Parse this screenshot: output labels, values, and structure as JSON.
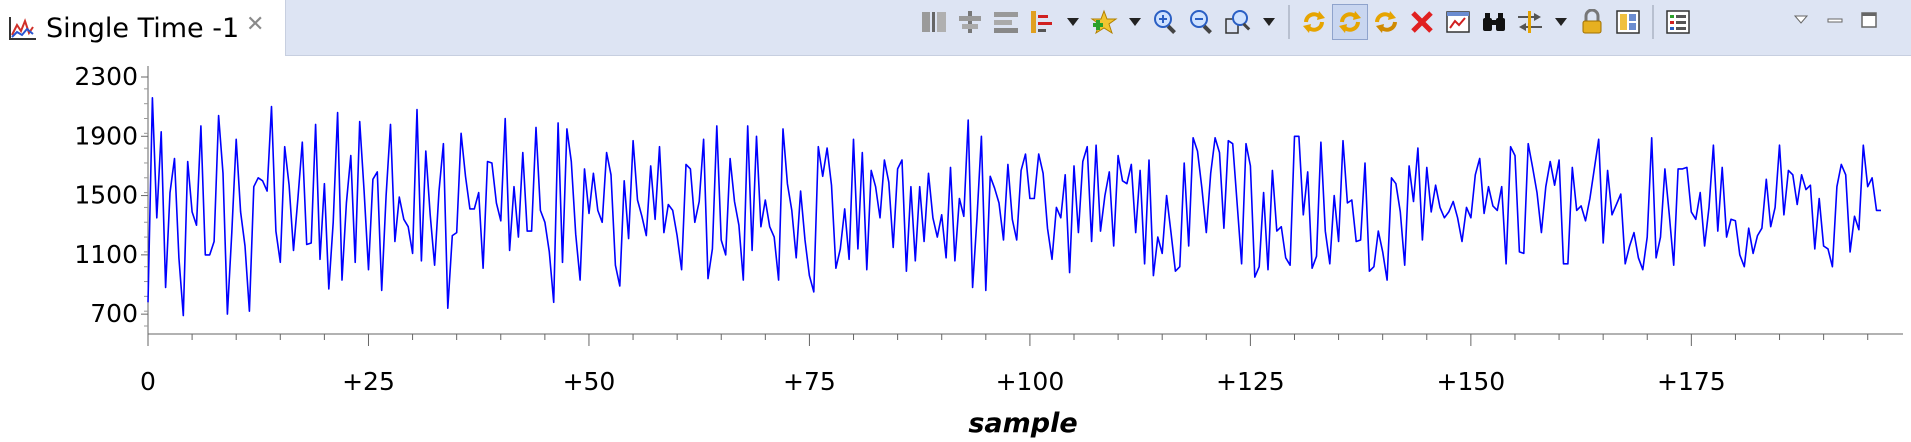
{
  "tab": {
    "title": "Single Time -1",
    "icon": "line-chart-icon",
    "close_icon": "close-icon"
  },
  "toolbar": {
    "icons": [
      "split-view-icon",
      "align-center-icon",
      "align-rows-icon",
      "measurement-marker-icon",
      "dropdown-arrow-icon",
      "add-graph-icon",
      "dropdown-arrow-icon",
      "zoom-in-icon",
      "zoom-out-icon",
      "zoom-fit-icon",
      "dropdown-arrow-icon",
      "refresh-icon",
      "continuous-refresh-icon",
      "refresh-all-icon",
      "delete-icon",
      "graph-properties-icon",
      "find-icon",
      "import-export-icon",
      "dropdown-arrow-icon",
      "lock-icon",
      "layout-icon",
      "list-icon"
    ]
  },
  "window": {
    "icons": [
      "view-menu-icon",
      "minimize-icon",
      "maximize-icon"
    ]
  },
  "colors": {
    "series": "#0000ff",
    "header_bg": "#dde4f3"
  },
  "chart_data": {
    "type": "line",
    "title": "",
    "xlabel": "sample",
    "ylabel": "",
    "x_tick_labels": [
      "0",
      "+25",
      "+50",
      "+75",
      "+100",
      "+125",
      "+150",
      "+175"
    ],
    "x_ticks": [
      0,
      25,
      50,
      75,
      100,
      125,
      150,
      175
    ],
    "y_tick_labels": [
      "2300",
      "1900",
      "1500",
      "1100",
      "700"
    ],
    "y_ticks": [
      2300,
      1900,
      1500,
      1100,
      700
    ],
    "xlim": [
      0,
      199
    ],
    "ylim": [
      620,
      2300
    ],
    "grid": false,
    "series": [
      {
        "name": "",
        "color": "#0000ff",
        "x_start": 0,
        "x_step": 0.5,
        "values": [
          780,
          2160,
          1350,
          1930,
          880,
          1520,
          1750,
          1080,
          690,
          1730,
          1390,
          1300,
          1970,
          1100,
          1100,
          1190,
          2040,
          1650,
          700,
          1250,
          1880,
          1390,
          1160,
          720,
          1560,
          1620,
          1600,
          1530,
          2100,
          1260,
          1050,
          1830,
          1570,
          1130,
          1480,
          1860,
          1170,
          1180,
          1980,
          1070,
          1580,
          870,
          1320,
          2060,
          930,
          1450,
          1770,
          1050,
          2000,
          1530,
          1000,
          1610,
          1660,
          860,
          1500,
          1980,
          1190,
          1490,
          1340,
          1290,
          1110,
          2080,
          1060,
          1800,
          1370,
          1030,
          1530,
          1850,
          740,
          1230,
          1250,
          1920,
          1630,
          1410,
          1410,
          1520,
          1010,
          1730,
          1720,
          1450,
          1330,
          2020,
          1130,
          1560,
          1220,
          1790,
          1260,
          1260,
          1960,
          1400,
          1320,
          1120,
          780,
          1990,
          1050,
          1950,
          1730,
          1240,
          930,
          1680,
          1380,
          1650,
          1400,
          1320,
          1790,
          1640,
          1030,
          890,
          1600,
          1210,
          1870,
          1470,
          1360,
          1230,
          1700,
          1340,
          1830,
          1250,
          1440,
          1400,
          1230,
          1000,
          1710,
          1680,
          1320,
          1460,
          1880,
          940,
          1140,
          1970,
          1200,
          1100,
          1750,
          1460,
          1300,
          930,
          1970,
          1130,
          1900,
          1290,
          1470,
          1290,
          1220,
          930,
          1950,
          1580,
          1400,
          1080,
          1530,
          1200,
          960,
          850,
          1830,
          1630,
          1820,
          1570,
          1010,
          1140,
          1410,
          1070,
          1880,
          1140,
          1790,
          1000,
          1670,
          1560,
          1350,
          1740,
          1590,
          1150,
          1680,
          1740,
          990,
          1560,
          1060,
          1560,
          1190,
          1650,
          1350,
          1220,
          1370,
          1080,
          1690,
          1060,
          1480,
          1360,
          2010,
          880,
          1350,
          1900,
          860,
          1630,
          1550,
          1450,
          1200,
          1710,
          1340,
          1200,
          1670,
          1780,
          1480,
          1480,
          1780,
          1650,
          1280,
          1070,
          1420,
          1350,
          1640,
          980,
          1700,
          1250,
          1730,
          1830,
          1190,
          1840,
          1260,
          1500,
          1660,
          1160,
          1770,
          1600,
          1580,
          1710,
          1250,
          1670,
          1040,
          1740,
          960,
          1220,
          1110,
          1500,
          1250,
          990,
          1020,
          1720,
          1160,
          1890,
          1800,
          1550,
          1250,
          1650,
          1890,
          1790,
          1280,
          1870,
          1850,
          1440,
          1040,
          1850,
          1700,
          950,
          1020,
          1520,
          1000,
          1670,
          1260,
          1290,
          1080,
          1030,
          1900,
          1900,
          1370,
          1660,
          1010,
          1090,
          1860,
          1260,
          1040,
          1500,
          1190,
          1870,
          1450,
          1470,
          1190,
          1200,
          1720,
          990,
          1020,
          1260,
          1120,
          930,
          1620,
          1580,
          1390,
          1030,
          1700,
          1460,
          1820,
          1200,
          1690,
          1390,
          1570,
          1420,
          1350,
          1390,
          1460,
          1350,
          1190,
          1420,
          1350,
          1640,
          1750,
          1380,
          1560,
          1430,
          1400,
          1560,
          1040,
          1830,
          1770,
          1120,
          1110,
          1850,
          1690,
          1520,
          1250,
          1560,
          1730,
          1570,
          1740,
          1040,
          1040,
          1690,
          1400,
          1430,
          1330,
          1480,
          1680,
          1880,
          1180,
          1670,
          1370,
          1440,
          1510,
          1040,
          1160,
          1250,
          1080,
          1000,
          1220,
          1890,
          1080,
          1220,
          1680,
          1370,
          1030,
          1680,
          1680,
          1690,
          1390,
          1340,
          1520,
          1160,
          1420,
          1840,
          1260,
          1690,
          1220,
          1340,
          1330,
          1100,
          1020,
          1280,
          1110,
          1230,
          1280,
          1610,
          1290,
          1420,
          1840,
          1370,
          1670,
          1640,
          1440,
          1640,
          1540,
          1570,
          1140,
          1480,
          1160,
          1140,
          1020,
          1560,
          1710,
          1640,
          1120,
          1360,
          1270,
          1840,
          1560,
          1620,
          1400,
          1400
        ]
      }
    ]
  }
}
